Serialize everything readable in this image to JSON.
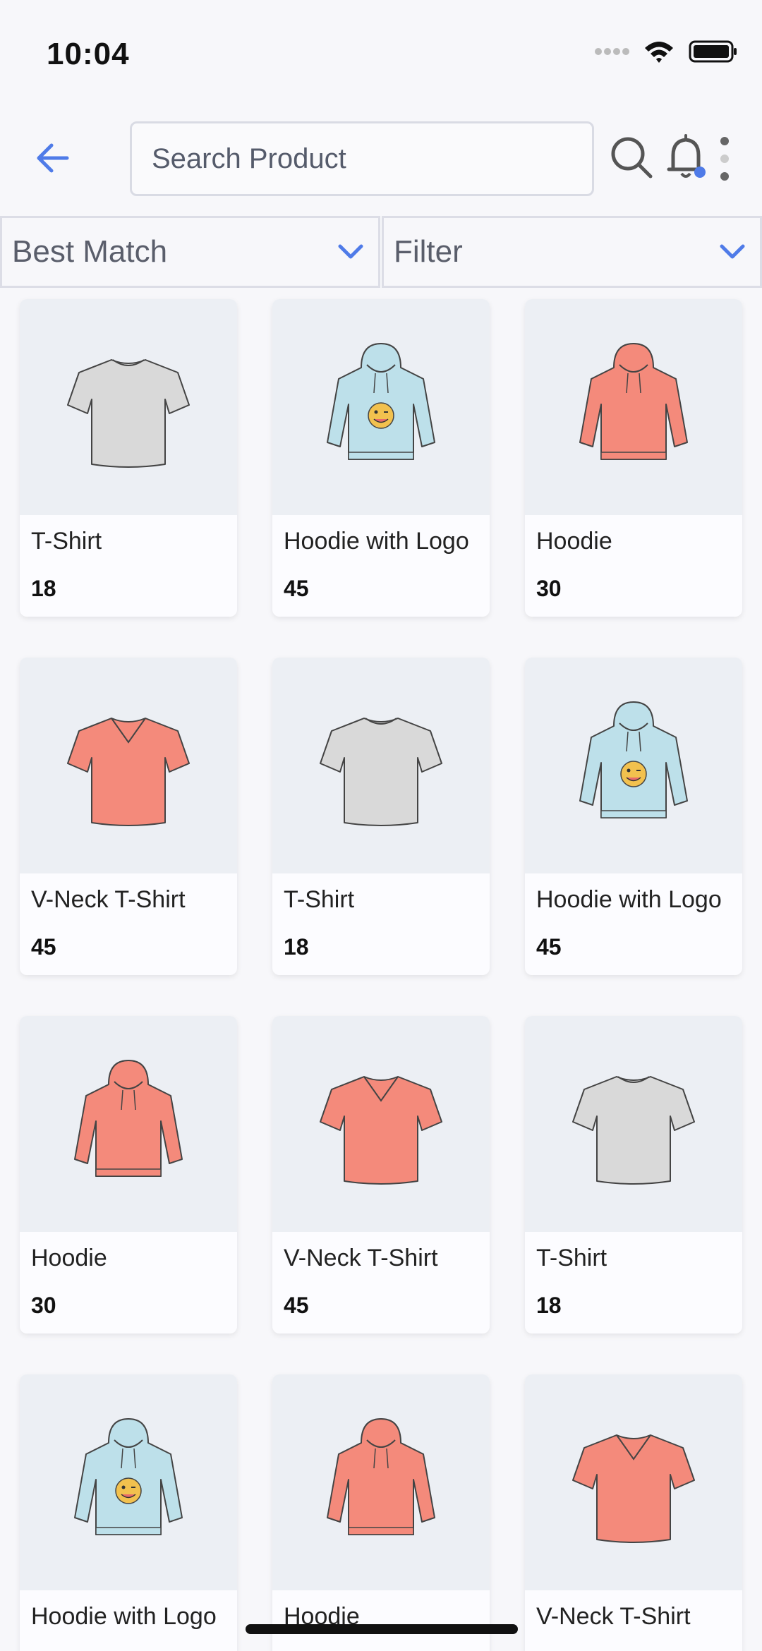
{
  "status_bar": {
    "time": "10:04"
  },
  "header": {
    "search_placeholder": "Search Product"
  },
  "sort": {
    "label": "Best Match"
  },
  "filter": {
    "label": "Filter"
  },
  "colors": {
    "accent": "#4f7be8",
    "gray_garment": "#d9d9d9",
    "red_garment": "#f48a7b",
    "blue_garment": "#bde0ea"
  },
  "products": [
    {
      "name": "T-Shirt",
      "price": "18",
      "kind": "tshirt",
      "color": "gray"
    },
    {
      "name": "Hoodie with Logo",
      "price": "45",
      "kind": "hoodie-logo",
      "color": "blue"
    },
    {
      "name": "Hoodie",
      "price": "30",
      "kind": "hoodie",
      "color": "red"
    },
    {
      "name": "V-Neck T-Shirt",
      "price": "45",
      "kind": "vneck",
      "color": "red"
    },
    {
      "name": "T-Shirt",
      "price": "18",
      "kind": "tshirt",
      "color": "gray"
    },
    {
      "name": "Hoodie with Logo",
      "price": "45",
      "kind": "hoodie-logo",
      "color": "blue"
    },
    {
      "name": "Hoodie",
      "price": "30",
      "kind": "hoodie",
      "color": "red"
    },
    {
      "name": "V-Neck T-Shirt",
      "price": "45",
      "kind": "vneck",
      "color": "red"
    },
    {
      "name": "T-Shirt",
      "price": "18",
      "kind": "tshirt",
      "color": "gray"
    },
    {
      "name": "Hoodie with Logo",
      "price": "",
      "kind": "hoodie-logo",
      "color": "blue"
    },
    {
      "name": "Hoodie",
      "price": "",
      "kind": "hoodie",
      "color": "red"
    },
    {
      "name": "V-Neck T-Shirt",
      "price": "",
      "kind": "vneck",
      "color": "red"
    }
  ]
}
